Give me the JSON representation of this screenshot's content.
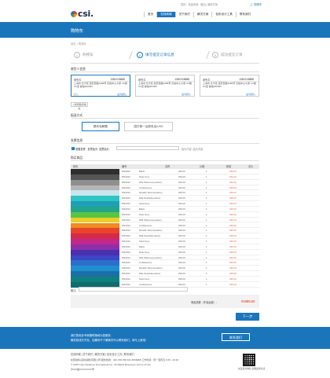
{
  "header": {
    "greeting": "您好，欢迎来到 · 退出 | 我的订单",
    "cart": "购物车",
    "nav": [
      "首页",
      "在线商城",
      "关于我们",
      "解决方案",
      "色彩设计工具",
      "联系我们"
    ],
    "nav_active": 1
  },
  "page_title": "购物车",
  "breadcrumb": "首页 > 购物车",
  "steps": [
    {
      "num": "1",
      "label": "购物车"
    },
    {
      "num": "2",
      "label": "填写提交订单信息"
    },
    {
      "num": "3",
      "label": "成功提交订单"
    }
  ],
  "sections": {
    "receiver": "收货人信息",
    "delivery": "配送方式",
    "invoice": "发票信息",
    "products": "购买商品"
  },
  "addresses": [
    {
      "name": "张先生",
      "phone": "138XXX8888",
      "text": "上海市 长宁区 延安西路1088号 长峰中心大厦 XX楼XX室 邮编200050",
      "default": "默认",
      "action": "设为默认"
    },
    {
      "name": "张先生",
      "phone": "138XXX8888",
      "text": "上海市 长宁区 延安西路1088号 长峰中心大厦 XX楼XX室 邮编200050",
      "default": "",
      "action": "设为默认"
    },
    {
      "name": "张先生",
      "phone": "138XXX8888",
      "text": "上海市 长宁区 延安西路1088号 长峰中心大厦 XX楼XX室 邮编200050",
      "default": "",
      "action": "设为默认"
    }
  ],
  "add_address": "+ 新增收货地址",
  "delivery_options": [
    "顺丰包邮费",
    "国外第一运费电话/USD"
  ],
  "invoice": {
    "checkbox_label": "需要发票",
    "title_label": "发票抬头: 发票抬头:",
    "hint": "抬头内容: 抬头内容"
  },
  "table": {
    "headers": [
      "颜色",
      "编号",
      "名称",
      "价格",
      "数量",
      "总价"
    ],
    "rows": [
      {
        "color": "#2e2e2e",
        "code": "MS301C",
        "name": "Black",
        "price": "¥90.00",
        "qty": "1",
        "total": "¥90.00"
      },
      {
        "color": "#555555",
        "code": "MS301C",
        "name": "Dark Grey",
        "price": "¥90.00",
        "qty": "1",
        "total": "¥90.00"
      },
      {
        "color": "#8f8f8f",
        "code": "MS301C",
        "name": "Milk Platinum(Leather)",
        "price": "¥90.00",
        "qty": "1",
        "total": "¥90.00"
      },
      {
        "color": "#b5b5b5",
        "code": "MS301C",
        "name": "Cobblestone",
        "price": "¥90.00",
        "qty": "1",
        "total": "¥90.00"
      },
      {
        "color": "#c8e6ee",
        "code": "MS301C",
        "name": "Metallic Silver(Leather)",
        "price": "¥90.00",
        "qty": "1",
        "total": "¥90.00"
      },
      {
        "color": "#2ec5c2",
        "code": "MS301C",
        "name": "Milk Pearlist(Leather)",
        "price": "¥90.00",
        "qty": "1",
        "total": "¥90.00"
      },
      {
        "color": "#1f9fb8",
        "code": "MS301C",
        "name": "Shell Grey",
        "price": "¥90.00",
        "qty": "1",
        "total": "¥90.00"
      },
      {
        "color": "#22a58a",
        "code": "MS301C",
        "name": "Black",
        "price": "¥90.00",
        "qty": "1",
        "total": "¥90.00"
      },
      {
        "color": "#5cc443",
        "code": "MS301C",
        "name": "Dark Grey",
        "price": "¥90.00",
        "qty": "1",
        "total": "¥90.00"
      },
      {
        "color": "#e8cf2a",
        "code": "MS301C",
        "name": "Milk Platinum(Leather)",
        "price": "¥90.00",
        "qty": "1",
        "total": "¥90.00"
      },
      {
        "color": "#f08a22",
        "code": "MS301C",
        "name": "Cobblestone",
        "price": "¥90.00",
        "qty": "1",
        "total": "¥90.00"
      },
      {
        "color": "#e8442a",
        "code": "MS301C",
        "name": "Metallic Silver(Leather)",
        "price": "¥90.00",
        "qty": "1",
        "total": "¥90.00"
      },
      {
        "color": "#d42a4a",
        "code": "MS301C",
        "name": "Milk Pearlist(Leather)",
        "price": "¥90.00",
        "qty": "1",
        "total": "¥90.00"
      },
      {
        "color": "#c2278a",
        "code": "MS301C",
        "name": "Shell Grey",
        "price": "¥90.00",
        "qty": "1",
        "total": "¥90.00"
      },
      {
        "color": "#8e2fa8",
        "code": "MS301C",
        "name": "Black",
        "price": "¥90.00",
        "qty": "1",
        "total": "¥90.00"
      },
      {
        "color": "#4a2fb0",
        "code": "MS301C",
        "name": "Dark Grey",
        "price": "¥90.00",
        "qty": "1",
        "total": "¥90.00"
      },
      {
        "color": "#3b47c4",
        "code": "MS301C",
        "name": "Milk Platinum(Leather)",
        "price": "¥90.00",
        "qty": "1",
        "total": "¥90.00"
      },
      {
        "color": "#2b6fc9",
        "code": "MS301C",
        "name": "Cobblestone",
        "price": "¥90.00",
        "qty": "1",
        "total": "¥90.00"
      },
      {
        "color": "#1d8fcf",
        "code": "MS301C",
        "name": "Metallic Silver(Leather)",
        "price": "¥90.00",
        "qty": "1",
        "total": "¥90.00"
      },
      {
        "color": "#1a6fa8",
        "code": "MS301C",
        "name": "Milk Pearlist(Leather)",
        "price": "¥90.00",
        "qty": "1",
        "total": "¥90.00"
      },
      {
        "color": "#127f7f",
        "code": "MS301C",
        "name": "Shell Grey",
        "price": "¥90.00",
        "qty": "1",
        "total": "¥90.00"
      },
      {
        "color": "#0e6d6d",
        "code": "MS301C",
        "name": "Cobblestone",
        "price": "¥90.00",
        "qty": "1",
        "total": "¥90.00"
      }
    ]
  },
  "remark_label": "备注:",
  "summary": {
    "label": "商品总额（不含运费）：",
    "value": "¥1980.00"
  },
  "next_button": "下一步",
  "bottom_banner": {
    "line1": "我们的色彩专家随时随地为您服务",
    "line2": "服务热线打开至，如果你不了解我们可以联系我们，请马上致电！",
    "button": "联系我们"
  },
  "footer": {
    "links": "在线商城 | 关于我们 | 解决方案 | 色彩设计工具 | 联系我们",
    "info": "杜邦颜料(深圳)销售有限公司 服务热线：400-708-708 021-6666888  工作时间：周一至周五 8:45 - 20:00",
    "copy": "© 2015 Color Solutions International Inc., All Rights Reserved | Terms of Use",
    "icp": "沪ICP备XXXXXXXX号",
    "qr_caption": "关注官方微信·获取最新信息"
  },
  "colors": {
    "brand": "#1b75bb",
    "price": "#e8663d"
  }
}
